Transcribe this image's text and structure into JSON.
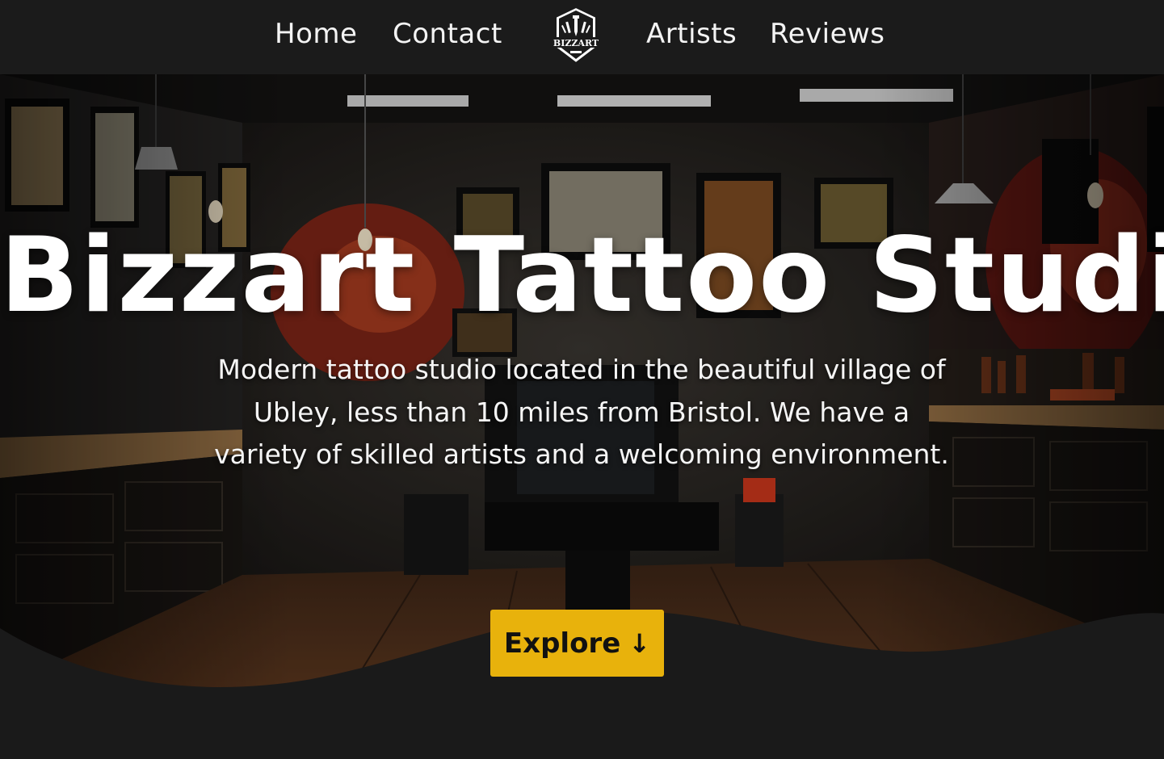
{
  "nav": {
    "home": "Home",
    "contact": "Contact",
    "artists": "Artists",
    "reviews": "Reviews"
  },
  "logo": {
    "text": "BIZZART",
    "icon": "tattoo-machine-shield-logo"
  },
  "hero": {
    "title": "Bizzart Tattoo Studio",
    "description": "Modern tattoo studio located in the beautiful village of Ubley, less than 10 miles from Bristol. We have a variety of skilled artists and a welcoming environment.",
    "button_label": "Explore",
    "button_arrow": "↓"
  },
  "colors": {
    "navbar_bg": "#1b1b1b",
    "accent": "#e8b20c",
    "text": "#ffffff",
    "wave": "#1a1a1a"
  }
}
